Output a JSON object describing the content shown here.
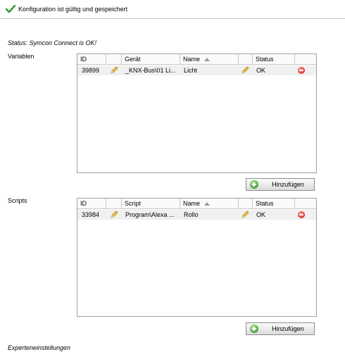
{
  "header": {
    "message": "Konfiguration ist gültig und gespeichert"
  },
  "status": "Status: Symcon Connect is OK!",
  "variablen": {
    "label": "Variablen",
    "columns": {
      "id": "ID",
      "geraet": "Gerät",
      "name": "Name",
      "status": "Status"
    },
    "rows": [
      {
        "id": "39899",
        "geraet": "_KNX-Bus\\01 Li...",
        "name": "Licht",
        "status": "OK"
      }
    ],
    "add_label": "Hinzufügen"
  },
  "scripts": {
    "label": "Scripts",
    "columns": {
      "id": "ID",
      "script": "Script",
      "name": "Name",
      "status": "Status"
    },
    "rows": [
      {
        "id": "33984",
        "script": "Program\\Alexa ...",
        "name": "Rollo",
        "status": "OK"
      }
    ],
    "add_label": "Hinzufügen"
  },
  "expert_settings": "Experteneinstellungen",
  "icons": {
    "check": "checkmark-icon",
    "edit": "pencil-icon",
    "delete": "minus-circle-icon",
    "add": "plus-circle-icon",
    "sort": "sort-ascending-icon"
  },
  "colors": {
    "check": "#2f9e3a",
    "delete": "#d9362a",
    "add": "#3c9a2a",
    "row_bg": "#f0f0f0"
  }
}
